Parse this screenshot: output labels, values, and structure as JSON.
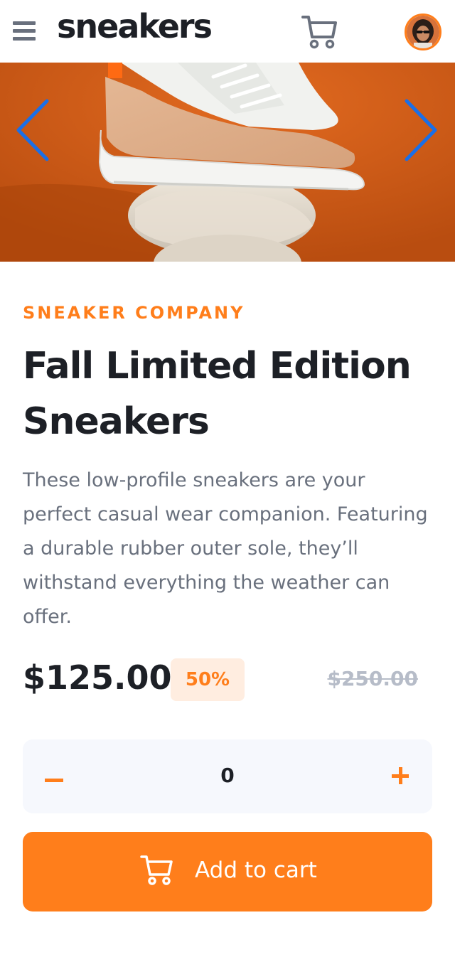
{
  "header": {
    "logo": "sneakers",
    "menu_icon": "hamburger-menu-icon",
    "cart_icon": "cart-icon",
    "avatar_icon": "user-avatar"
  },
  "gallery": {
    "prev_icon": "chevron-left-icon",
    "next_icon": "chevron-right-icon",
    "image": "sneaker-product-photo"
  },
  "product": {
    "company": "SNEAKER COMPANY",
    "title": "Fall Limited Edition Sneakers",
    "description": "These low-profile sneakers are your perfect casual wear companion. Featuring a durable rubber outer sole, they’ll withstand everything the weather can offer.",
    "price": "$125.00",
    "discount": "50%",
    "old_price": "$250.00"
  },
  "quantity": {
    "value": "0",
    "minus_icon": "minus-icon",
    "plus_icon": "plus-icon"
  },
  "add_to_cart": {
    "label": "Add to cart",
    "icon": "cart-icon"
  },
  "colors": {
    "accent": "#ff7e1b",
    "accent_light": "#ffede0",
    "dark": "#1d2026",
    "gray": "#69707d",
    "arrow_blue": "#1a6fe8"
  }
}
